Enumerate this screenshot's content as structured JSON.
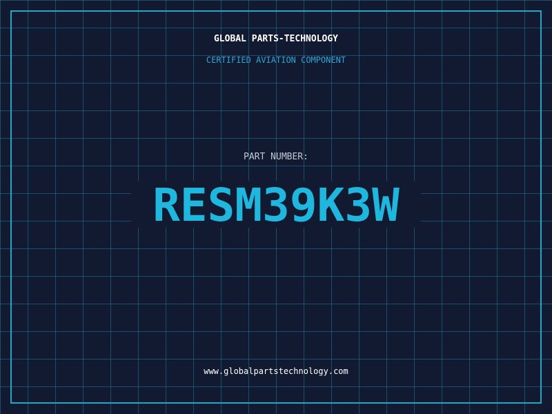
{
  "header": {
    "company": "GLOBAL PARTS-TECHNOLOGY",
    "tagline": "CERTIFIED AVIATION COMPONENT"
  },
  "part": {
    "label": "PART NUMBER:",
    "number": "RESM39K3W"
  },
  "footer": {
    "url": "www.globalpartstechnology.com"
  },
  "colors": {
    "background": "#111a30",
    "grid": "#267696",
    "frame": "#1ca8c9",
    "accent": "#1fb7de",
    "tagline": "#2ea6d6"
  }
}
